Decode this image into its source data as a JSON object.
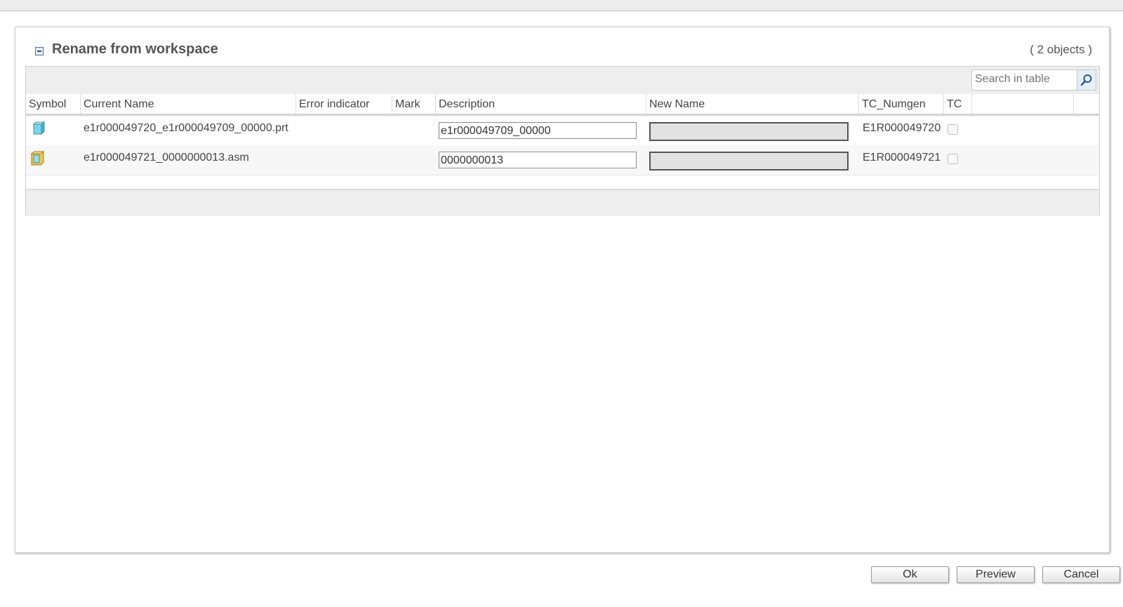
{
  "dialog": {
    "title": "Rename from workspace",
    "object_count": "( 2 objects )"
  },
  "search": {
    "placeholder": "Search in table"
  },
  "table": {
    "columns": [
      "Symbol",
      "Current Name",
      "Error indicator",
      "Mark",
      "Description",
      "New Name",
      "TC_Numgen",
      "TC"
    ],
    "rows": [
      {
        "symbol": "part-icon",
        "current_name": "e1r000049720_e1r000049709_00000.prt",
        "error_indicator": "",
        "mark": "",
        "description": "e1r000049709_00000",
        "new_name": "",
        "tc_numgen": "E1R000049720",
        "tc_checked": false
      },
      {
        "symbol": "assembly-icon",
        "current_name": "e1r000049721_0000000013.asm",
        "error_indicator": "",
        "mark": "",
        "description": "0000000013",
        "new_name": "",
        "tc_numgen": "E1R000049721",
        "tc_checked": false
      }
    ]
  },
  "buttons": {
    "ok": "Ok",
    "preview": "Preview",
    "cancel": "Cancel"
  },
  "colors": {
    "part_icon": "#7fd3e6",
    "assembly_icon": "#f2c94c",
    "search_icon": "#2b5a9e"
  }
}
